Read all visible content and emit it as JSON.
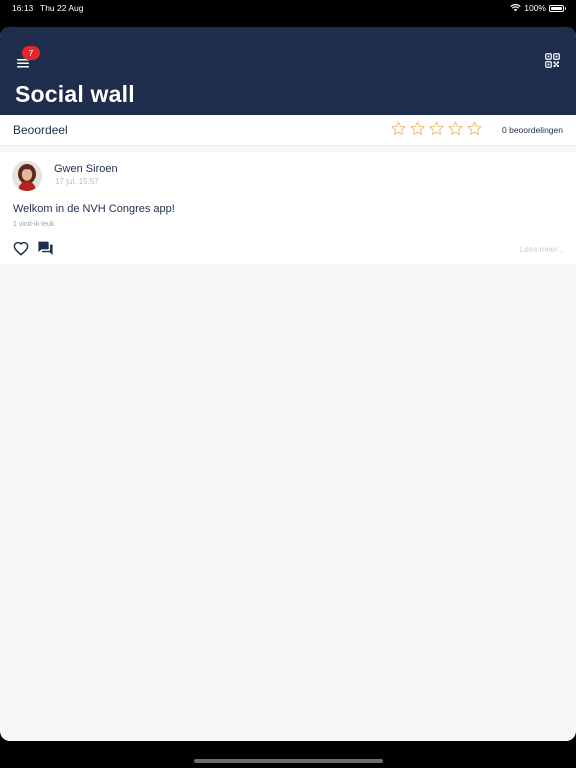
{
  "status_bar": {
    "time": "16:13",
    "date": "Thu 22 Aug",
    "battery": "100%",
    "icons": [
      "wifi-icon",
      "battery-icon"
    ]
  },
  "header": {
    "title": "Social wall",
    "notification_count": "7",
    "background_color": "#1e2d4c",
    "icons": [
      "menu-icon",
      "qr-code-icon"
    ]
  },
  "rating": {
    "label": "Beoordeel",
    "stars_total": 5,
    "stars_filled": 0,
    "star_color": "#f0b877",
    "count_label": "0 beoordelingen"
  },
  "posts": [
    {
      "author": "Gwen Siroen",
      "timestamp": "17 jul. 15:57",
      "text": "Welkom in de NVH Congres app!",
      "likes": "1 vind-ik-leuk",
      "read_more": "Lees meer...",
      "icons": [
        "heart-icon",
        "comment-icon"
      ]
    }
  ],
  "badge_color": "#e3262e"
}
